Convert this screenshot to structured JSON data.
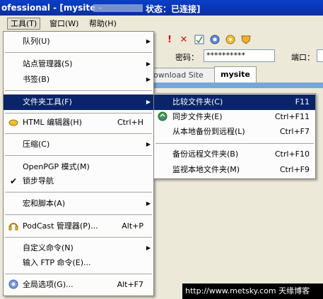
{
  "title": {
    "prefix": "ofessional - [mysite -",
    "suffix": "状态：已连接]"
  },
  "menubar": [
    {
      "label": "工具(T)",
      "active": true
    },
    {
      "label": "窗口(W)",
      "active": false
    },
    {
      "label": "帮助(H)",
      "active": false
    }
  ],
  "connection": {
    "password_label": "密码：",
    "password_value": "**********",
    "port_label": "端口："
  },
  "tabs": {
    "tab1": "ownload Site",
    "tab2": "mysite"
  },
  "menu": {
    "queue": "队列(U)",
    "site_manager": "站点管理器(S)",
    "bookmarks": "书签(B)",
    "folder_tools": "文件夹工具(F)",
    "html_editor": "HTML 编辑器(H)",
    "html_editor_shortcut": "Ctrl+H",
    "compress": "压缩(C)",
    "openpgp": "OpenPGP 模式(M)",
    "lock_nav": "锁步导航",
    "macros": "宏和脚本(A)",
    "podcast": "PodCast 管理器(P)...",
    "podcast_shortcut": "Alt+P",
    "custom_cmd": "自定义命令(N)",
    "ftp_cmd": "输入 FTP 命令(E)...",
    "global_options": "全局选项(G)...",
    "global_options_shortcut": "Alt+F7"
  },
  "submenu": {
    "compare": "比较文件夹(C)",
    "compare_shortcut": "F11",
    "sync": "同步文件夹(E)",
    "sync_shortcut": "Ctrl+F11",
    "backup_local": "从本地备份到远程(L)",
    "backup_local_shortcut": "Ctrl+F7",
    "backup_remote": "备份远程文件夹(B)",
    "backup_remote_shortcut": "Ctrl+F10",
    "monitor_local": "监视本地文件夹(M)",
    "monitor_local_shortcut": "Ctrl+F9"
  },
  "watermark": "http://www.metsky.com  天缘博客"
}
